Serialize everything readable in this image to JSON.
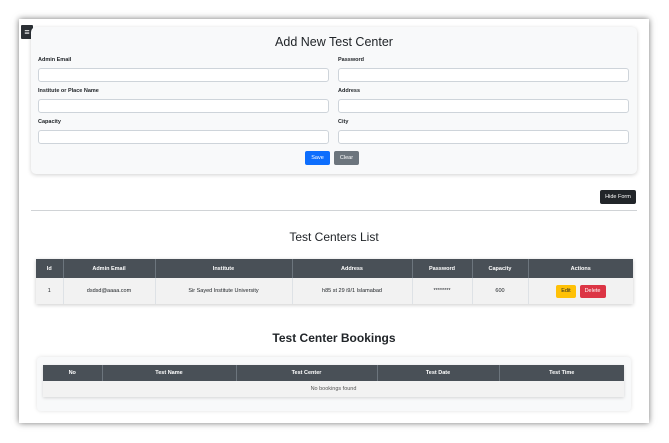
{
  "sidebar": {
    "toggle_glyph": "≡",
    "toggle_icon": "hamburger-menu-icon"
  },
  "form": {
    "title": "Add New Test Center",
    "fields": {
      "admin_email": {
        "label": "Admin Email",
        "value": ""
      },
      "password": {
        "label": "Password",
        "value": ""
      },
      "institute": {
        "label": "Institute or Place Name",
        "value": ""
      },
      "address": {
        "label": "Address",
        "value": ""
      },
      "capacity": {
        "label": "Capacity",
        "value": ""
      },
      "city": {
        "label": "City",
        "value": ""
      }
    },
    "save_label": "Save",
    "clear_label": "Clear"
  },
  "toggle_form_label": "Hide Form",
  "centers": {
    "title": "Test Centers List",
    "columns": [
      "Id",
      "Admin Email",
      "Institute",
      "Address",
      "Password",
      "Capacity",
      "Actions"
    ],
    "rows": [
      {
        "id": "1",
        "admin_email": "dsdsd@aaaa.com",
        "institute": "Sir Sayed Institute University",
        "address": "h85 st 29 i9/1 Islamabad",
        "password": "********",
        "capacity": "600",
        "edit_label": "Edit",
        "delete_label": "Delete"
      }
    ]
  },
  "bookings": {
    "title": "Test Center Bookings",
    "columns": [
      "No",
      "Test Name",
      "Test Center",
      "Test Date",
      "Test Time"
    ],
    "empty_message": "No bookings found"
  },
  "colors": {
    "primary": "#0d6efd",
    "secondary": "#6c757d",
    "warning": "#ffc107",
    "danger": "#dc3545",
    "dark": "#212529",
    "table_header": "#495057"
  }
}
